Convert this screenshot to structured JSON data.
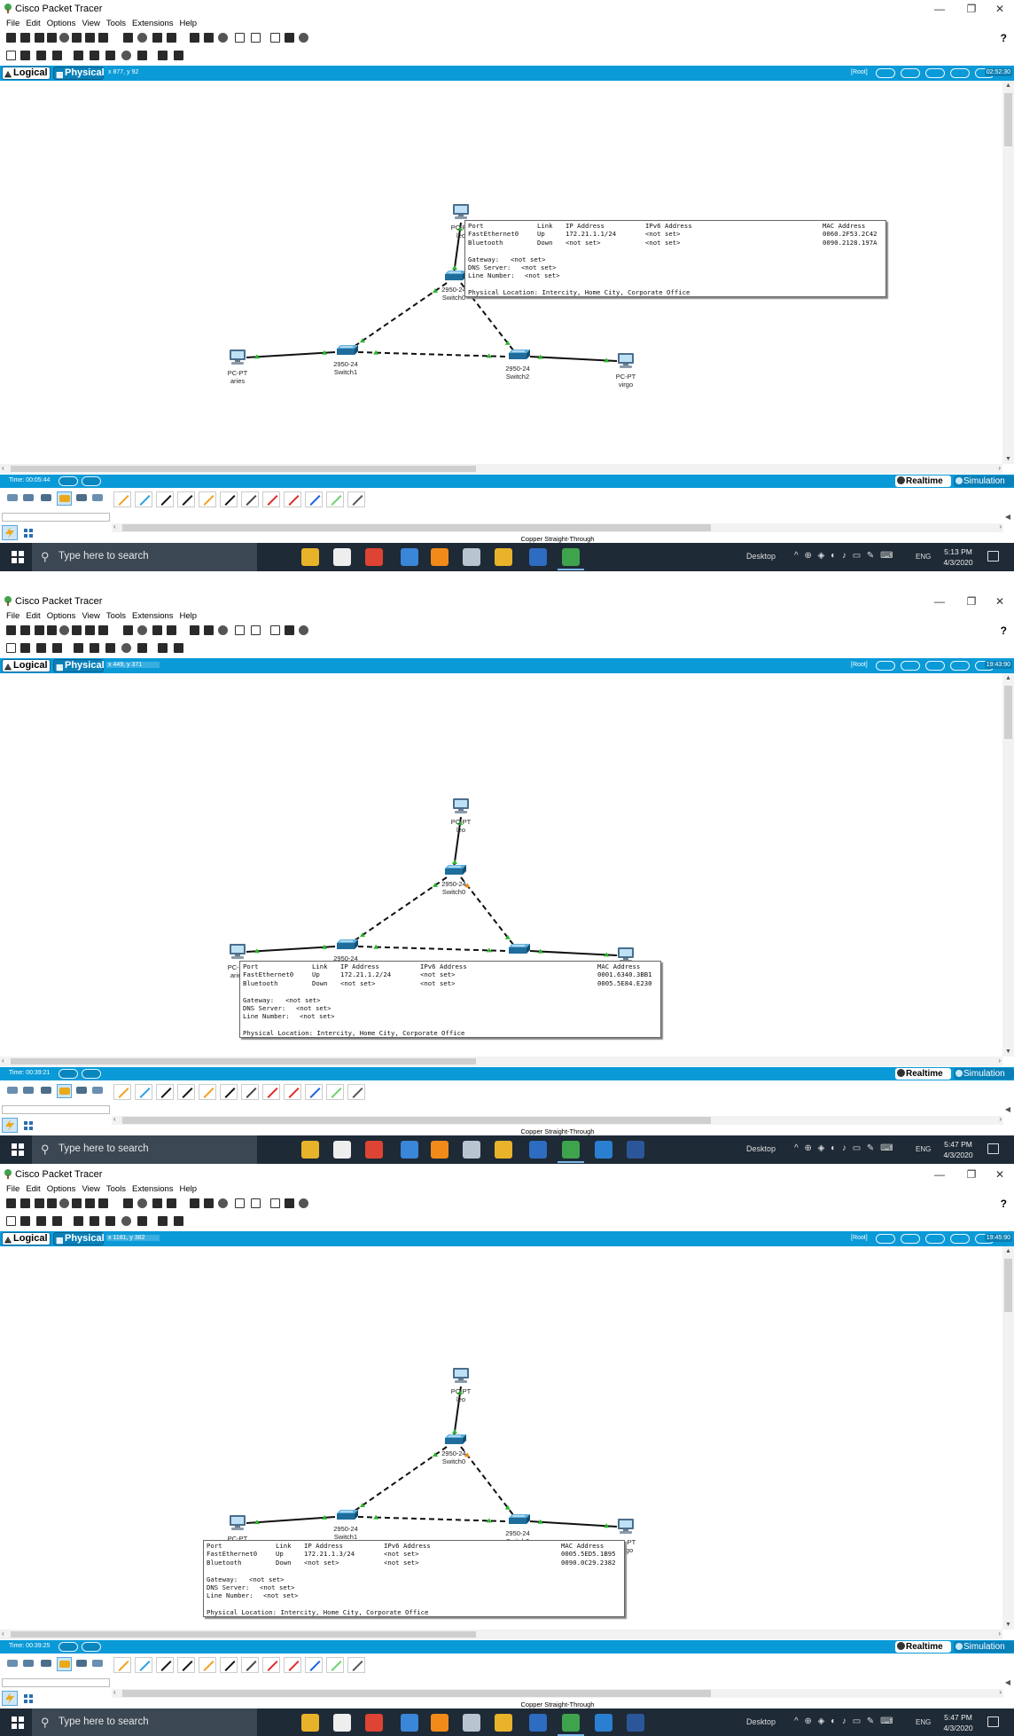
{
  "app": {
    "title": "Cisco Packet Tracer"
  },
  "menu": [
    "File",
    "Edit",
    "Options",
    "View",
    "Tools",
    "Extensions",
    "Help"
  ],
  "help_label": "?",
  "tabs": {
    "logical": "Logical",
    "physical": "Physical"
  },
  "root_label": "[Root]",
  "realtime_label": "Realtime",
  "simulation_label": "Simulation",
  "cable_label": "Copper Straight-Through",
  "search_placeholder": "Type here to search",
  "taskbar_desktop": "Desktop",
  "taskbar_lang": "ENG",
  "colors": {
    "accent": "#0a9ad8",
    "taskbar": "#1e2a36",
    "link": "#2bb52b"
  },
  "table_headers": [
    "Port",
    "Link",
    "IP Address",
    "IPv6 Address",
    "MAC Address"
  ],
  "labels": {
    "gateway": "Gateway:",
    "dns": "DNS Server:",
    "line": "Line Number:",
    "location": "Physical Location: Intercity, Home City, Corporate Office"
  },
  "devices": {
    "pc_type": "PC-PT",
    "switch_model": "2950-24",
    "pc_left": "aries",
    "pc_right": "virgo",
    "switch_left": "Switch1",
    "switch_right": "Switch2",
    "switch_top": "Switch0",
    "pc_top": "leo"
  },
  "shots": [
    {
      "coord": "x 877, y 92",
      "clock": "02:52:30",
      "time": "Time: 00:05:44",
      "tk_time": "5:13 PM",
      "tk_date": "4/3/2020",
      "pdu": {
        "rows": [
          [
            "FastEthernet0",
            "Up",
            "172.21.1.1/24",
            "<not set>",
            "0060.2F53.2C42"
          ],
          [
            "Bluetooth",
            "Down",
            "<not set>",
            "<not set>",
            "0090.2128.197A"
          ]
        ],
        "gateway": "<not set>",
        "dns": "<not set>",
        "line": "<not set>"
      }
    },
    {
      "coord": "x 449, y 371",
      "clock": "19:43:90",
      "time": "Time: 00:39:21",
      "tk_time": "5:47 PM",
      "tk_date": "4/3/2020",
      "pdu": {
        "rows": [
          [
            "FastEthernet0",
            "Up",
            "172.21.1.2/24",
            "<not set>",
            "0001.6340.3BB1"
          ],
          [
            "Bluetooth",
            "Down",
            "<not set>",
            "<not set>",
            "0005.5E84.E230"
          ]
        ],
        "gateway": "<not set>",
        "dns": "<not set>",
        "line": "<not set>"
      }
    },
    {
      "coord": "x 1181, y 382",
      "clock": "19:45:90",
      "time": "Time: 00:39:25",
      "tk_time": "5:47 PM",
      "tk_date": "4/3/2020",
      "pdu": {
        "rows": [
          [
            "FastEthernet0",
            "Up",
            "172.21.1.3/24",
            "<not set>",
            "0005.5ED5.1B95"
          ],
          [
            "Bluetooth",
            "Down",
            "<not set>",
            "<not set>",
            "0090.0C29.2382"
          ]
        ],
        "gateway": "<not set>",
        "dns": "<not set>",
        "line": "<not set>"
      }
    }
  ]
}
